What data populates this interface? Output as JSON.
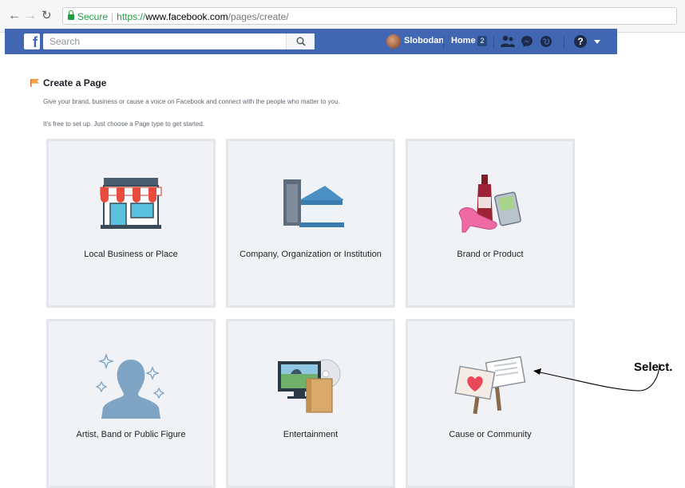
{
  "browser": {
    "secure_label": "Secure",
    "url_scheme": "https://",
    "url_host": "www.facebook.com",
    "url_path": "/pages/create/"
  },
  "fb_header": {
    "logo": "f",
    "search_placeholder": "Search",
    "profile_name": "Slobodan",
    "home_label": "Home",
    "home_badge": "2",
    "brand_color": "#4267b2"
  },
  "page": {
    "title": "Create a Page",
    "description": "Give your brand, business or cause a voice on Facebook and connect with the people who matter to you.",
    "sub_description": "It's free to set up. Just choose a Page type to get started."
  },
  "categories": [
    {
      "label": "Local Business or Place",
      "icon": "storefront-icon"
    },
    {
      "label": "Company, Organization or Institution",
      "icon": "building-icon"
    },
    {
      "label": "Brand or Product",
      "icon": "products-icon"
    },
    {
      "label": "Artist, Band or Public Figure",
      "icon": "person-silhouette-icon"
    },
    {
      "label": "Entertainment",
      "icon": "tv-disc-icon"
    },
    {
      "label": "Cause or Community",
      "icon": "protest-signs-icon"
    }
  ],
  "annotation": {
    "label": "Select."
  }
}
